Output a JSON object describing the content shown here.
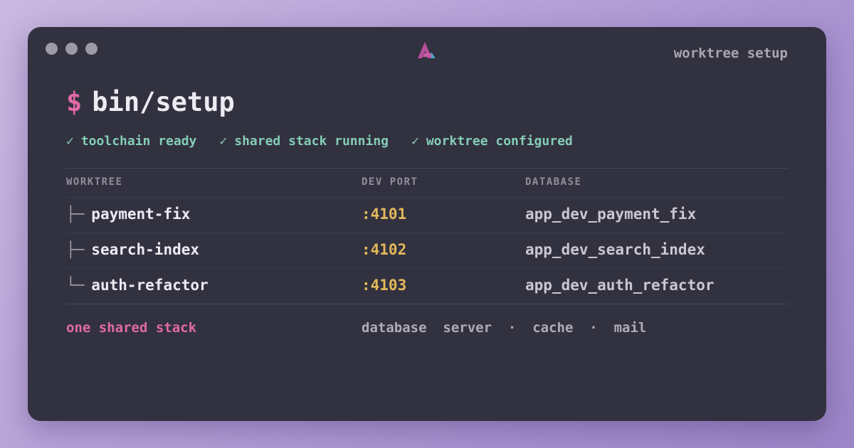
{
  "window": {
    "title": "worktree setup",
    "logo_icon": "app-logo-icon"
  },
  "command": {
    "prompt": "$",
    "text": "bin/setup"
  },
  "checks": [
    {
      "mark": "✓",
      "label": "toolchain ready"
    },
    {
      "mark": "✓",
      "label": "shared stack running"
    },
    {
      "mark": "✓",
      "label": "worktree configured"
    }
  ],
  "table": {
    "headers": [
      "WORKTREE",
      "DEV PORT",
      "DATABASE"
    ],
    "rows": [
      {
        "branch": "├─",
        "worktree": "payment-fix",
        "port": ":4101",
        "database": "app_dev_payment_fix"
      },
      {
        "branch": "├─",
        "worktree": "search-index",
        "port": ":4102",
        "database": "app_dev_search_index"
      },
      {
        "branch": "└─",
        "worktree": "auth-refactor",
        "port": ":4103",
        "database": "app_dev_auth_refactor"
      }
    ]
  },
  "footer": {
    "label": "one shared stack",
    "services": "database  server  ·  cache  ·  mail"
  },
  "colors": {
    "background": "#32313f",
    "accent_pink": "#e06aa7",
    "check_green": "#84cdb6",
    "port_yellow": "#e2b85a"
  }
}
